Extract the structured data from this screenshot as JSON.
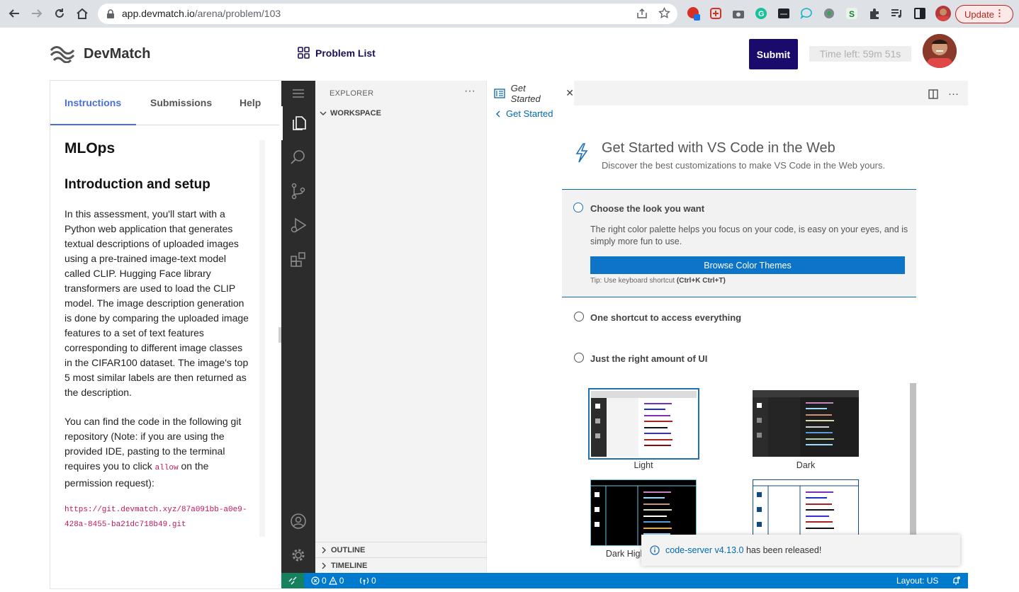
{
  "browser": {
    "url_host": "app.devmatch.io",
    "url_path": "/arena/problem/103",
    "update_label": "Update"
  },
  "header": {
    "brand": "DevMatch",
    "problem_list": "Problem List",
    "submit": "Submit",
    "time_left": "Time left: 59m 51s"
  },
  "left": {
    "tabs": [
      "Instructions",
      "Submissions",
      "Help"
    ],
    "title": "MLOps",
    "subtitle": "Introduction and setup",
    "para1": "In this assessment, you'll start with a Python web application that generates textual descriptions of uploaded images using a pre-trained image-text model called CLIP. Hugging Face library transformers are used to load the CLIP model. The image description generation is done by comparing the uploaded image features to a set of text features corresponding to different image classes in the CIFAR100 dataset. The image's top 5 most similar labels are then returned as the description.",
    "para2_before": "You can find the code in the following git repository (Note: if you are using the provided IDE, pasting to the terminal requires you to click ",
    "para2_code": "allow",
    "para2_after": " on the permission request):",
    "git_url": "https://git.devmatch.xyz/87a091bb-a0e9-428a-8455-ba21dc718b49.git"
  },
  "vscode": {
    "explorer": "EXPLORER",
    "workspace": "WORKSPACE",
    "outline": "OUTLINE",
    "timeline": "TIMELINE",
    "tab": "Get Started",
    "back": "Get Started",
    "title": "Get Started with VS Code in the Web",
    "subtitle": "Discover the best customizations to make VS Code in the Web yours.",
    "step1_title": "Choose the look you want",
    "step1_desc": "The right color palette helps you focus on your code, is easy on your eyes, and is simply more fun to use.",
    "step1_button": "Browse Color Themes",
    "tip_prefix": "Tip: Use keyboard shortcut ",
    "tip_keys": "(Ctrl+K Ctrl+T)",
    "step2_title": "One shortcut to access everything",
    "step3_title": "Just the right amount of UI",
    "themes": [
      "Light",
      "Dark",
      "Dark High Contrast"
    ],
    "notification_link": "code-server v4.13.0",
    "notification_text": "has been released!",
    "status_errors": "0",
    "status_warnings": "0",
    "status_ports": "0",
    "status_layout": "Layout: US"
  }
}
